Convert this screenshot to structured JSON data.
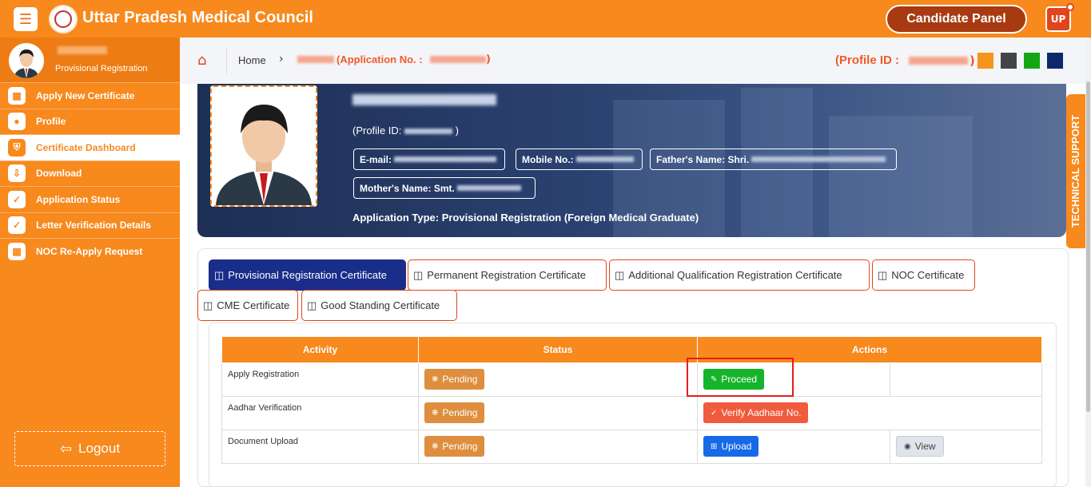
{
  "header": {
    "app_title": "Uttar Pradesh Medical Council",
    "candidate_panel": "Candidate Panel",
    "user_badge": "UP"
  },
  "sidebar": {
    "role": "Provisional Registration",
    "items": [
      {
        "label": "Apply New Certificate",
        "icon": "grid-icon"
      },
      {
        "label": "Profile",
        "icon": "user-icon"
      },
      {
        "label": "Certificate Dashboard",
        "icon": "shield-icon"
      },
      {
        "label": "Download",
        "icon": "download-icon"
      },
      {
        "label": "Application Status",
        "icon": "check-circle-icon"
      },
      {
        "label": "Letter Verification Details",
        "icon": "check-circle-icon"
      },
      {
        "label": "NOC Re-Apply Request",
        "icon": "grid-icon"
      }
    ],
    "active_index": 2,
    "logout": "Logout"
  },
  "breadcrumb": {
    "home": "Home",
    "application_prefix": "(Application No. :",
    "close": ")",
    "profile_prefix": "(Profile ID :",
    "profile_close": ")"
  },
  "theme_swatches": [
    "#f7941d",
    "#444444",
    "#13a813",
    "#0c2a6b"
  ],
  "technical_support": "TECHNICAL SUPPORT",
  "banner": {
    "profile_id_prefix": "(Profile ID:",
    "profile_id_close": ")",
    "email_label": "E-mail:",
    "mobile_label": "Mobile No.:",
    "father_label": "Father's Name: Shri.",
    "mother_label": "Mother's Name: Smt.",
    "application_type": "Application Type: Provisional Registration (Foreign Medical Graduate)"
  },
  "tabs": [
    "Provisional Registration Certificate",
    "Permanent Registration Certificate",
    "Additional Qualification Registration Certificate",
    "NOC Certificate",
    "CME Certificate",
    "Good Standing Certificate"
  ],
  "table": {
    "headers": [
      "Activity",
      "Status",
      "Actions"
    ],
    "rows": [
      {
        "activity": "Apply Registration",
        "status": "Pending",
        "action": "Proceed",
        "extra": ""
      },
      {
        "activity": "Aadhar Verification",
        "status": "Pending",
        "action": "Verify Aadhaar No.",
        "extra": ""
      },
      {
        "activity": "Document Upload",
        "status": "Pending",
        "action": "Upload",
        "extra": "View"
      }
    ]
  }
}
